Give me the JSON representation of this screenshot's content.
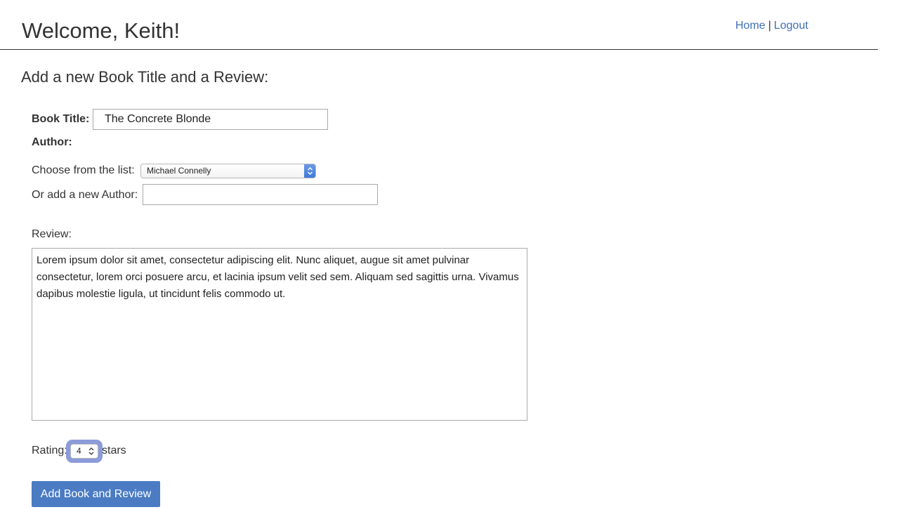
{
  "header": {
    "welcome": "Welcome, Keith!",
    "nav": {
      "home": "Home",
      "separator": "|",
      "logout": "Logout"
    }
  },
  "form": {
    "heading": "Add a new Book Title and a Review:",
    "book_title": {
      "label": "Book Title:",
      "value": "The Concrete Blonde"
    },
    "author_label": "Author:",
    "choose_author": {
      "label": "Choose from the list:",
      "selected": "Michael Connelly"
    },
    "new_author": {
      "label": "Or add a new Author:",
      "value": ""
    },
    "review": {
      "label": "Review:",
      "value": "Lorem ipsum dolor sit amet, consectetur adipiscing elit. Nunc aliquet, augue sit amet pulvinar consectetur, lorem orci posuere arcu, et lacinia ipsum velit sed sem. Aliquam sed sagittis urna. Vivamus dapibus molestie ligula, ut tincidunt felis commodo ut."
    },
    "rating": {
      "label": "Rating:",
      "value": "4",
      "suffix": "stars"
    },
    "submit_label": "Add Book and Review"
  },
  "colors": {
    "link": "#3f6fb5",
    "button": "#4a7bc3",
    "focus_ring": "#8c9bd9"
  }
}
